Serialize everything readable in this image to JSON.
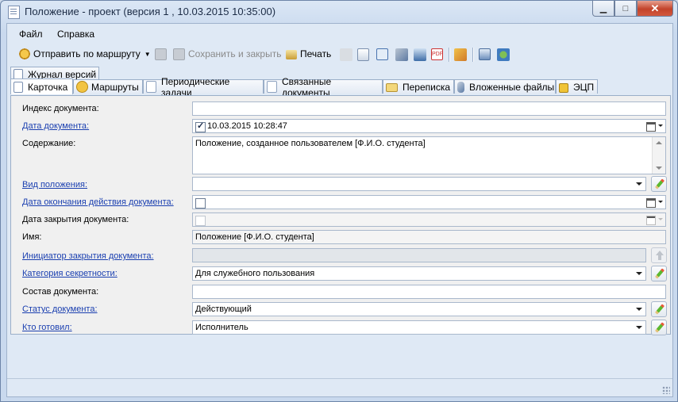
{
  "window": {
    "title": "Положение - проект (версия 1 , 10.03.2015 10:35:00)"
  },
  "menu": {
    "items": [
      "Файл",
      "Справка"
    ]
  },
  "toolbar": {
    "route_label": "Отправить по маршруту",
    "save_close_label": "Сохранить и закрыть",
    "print_label": "Печать",
    "icons": [
      "route-icon",
      "save-icon",
      "save-close-icon",
      "print-icon",
      "edit-icon",
      "approve-icon",
      "settings-icon",
      "attach-icon",
      "scan-icon",
      "pdf-icon",
      "sign-icon",
      "refresh-icon",
      "share-icon"
    ]
  },
  "tabs": {
    "outer": [
      "Журнал версий"
    ],
    "inner": [
      "Карточка",
      "Маршруты",
      "Периодические задачи",
      "Связанные документы",
      "Переписка",
      "Вложенные файлы",
      "ЭЦП"
    ]
  },
  "form": {
    "index_label": "Индекс документа:",
    "index_value": "",
    "date_label": "Дата документа:",
    "date_value": "10.03.2015 10:28:47",
    "content_label": "Содержание:",
    "content_value": "Положение, созданное пользователем [Ф.И.О. студента]",
    "kind_label": "Вид положения:",
    "kind_value": "",
    "end_date_label": "Дата окончания действия документа:",
    "close_date_label": "Дата закрытия документа:",
    "name_label": "Имя:",
    "name_value": "Положение [Ф.И.О. студента]",
    "initiator_label": "Инициатор закрытия документа:",
    "initiator_value": "",
    "secrecy_label": "Категория секретности:",
    "secrecy_value": "Для служебного пользования",
    "composition_label": "Состав документа:",
    "composition_value": "",
    "status_label": "Статус документа:",
    "status_value": "Действующий",
    "prepared_label": "Кто готовил:",
    "prepared_value": "Исполнитель"
  }
}
